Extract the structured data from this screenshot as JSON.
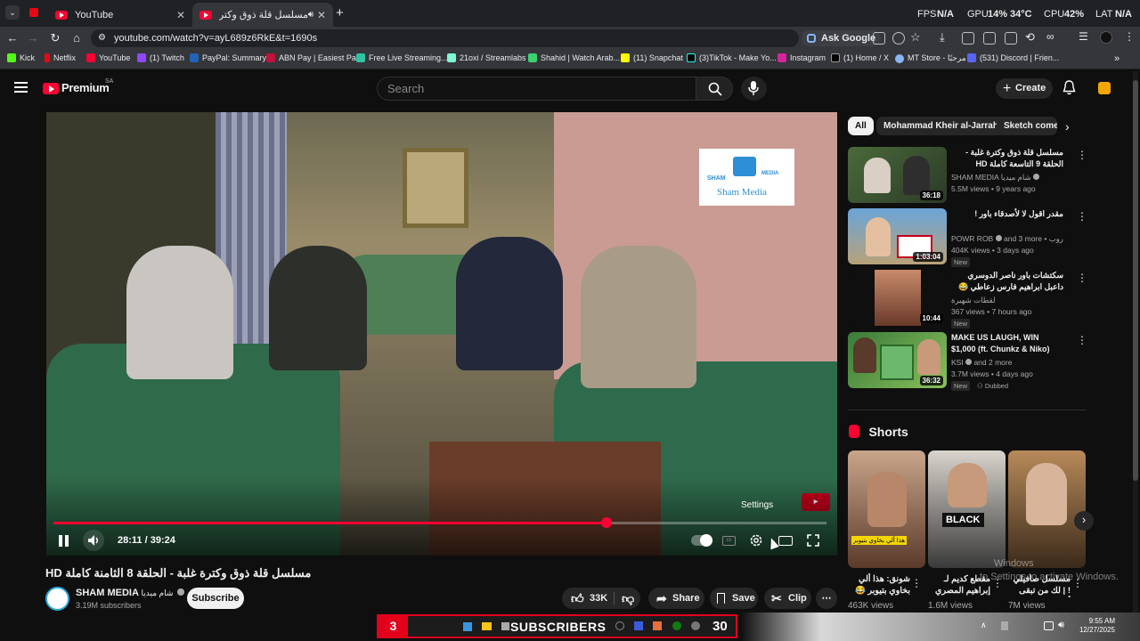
{
  "browser": {
    "tabs": [
      {
        "label": "YouTube",
        "active": false
      },
      {
        "label": "مسلسل قلة ذوق وكترة غلبة",
        "active": true
      }
    ],
    "hud": {
      "fps_label": "FPS",
      "fps": "N/A",
      "gpu_label": "GPU",
      "gpu": "14%",
      "gpu_temp": "34°C",
      "cpu_label": "CPU",
      "cpu": "42%",
      "lat_label": "LAT",
      "lat": "N/A"
    },
    "url": "youtube.com/watch?v=ayL689z6RkE&t=1690s",
    "ask_google": "Ask Google",
    "bookmarks": [
      "Kick",
      "Netflix",
      "YouTube",
      "(1) Twitch",
      "PayPal: Summary",
      "ABN Pay | Easiest Pa...",
      "Free Live Streaming...",
      "21oxi / Streamlabs",
      "Shahid | Watch Arab...",
      "(11) Snapchat",
      "(3)TikTok - Make Yo...",
      "Instagram",
      "(1) Home / X",
      "MT Store - مرحبًا",
      "(531) Discord | Frien..."
    ]
  },
  "masthead": {
    "logo": "Premium",
    "region": "SA",
    "search_placeholder": "Search",
    "create_label": "Create"
  },
  "player": {
    "time_current": "28:11",
    "time_total": "39:24",
    "progress": 0.715,
    "tooltip": "Settings",
    "overlay_logo_text": "Sham Media",
    "overlay_logo_tag": "SHAM",
    "overlay_logo_tag2": "MEDIA"
  },
  "video": {
    "title": "مسلسل قلة ذوق وكترة غلبة - الحلقة 8 الثامنة كاملة HD",
    "channel": "SHAM MEDIA",
    "channel_alt": "شام ميديا",
    "subscribers": "3.19M subscribers",
    "subscribe_label": "Subscribe",
    "likes": "33K",
    "share_label": "Share",
    "save_label": "Save",
    "clip_label": "Clip"
  },
  "sidebar": {
    "chips": [
      "All",
      "Mohammad Kheir al-Jarrah",
      "Sketch come"
    ],
    "videos": [
      {
        "title": "مسلسل قلة ذوق وكترة غلبة - الحلقة 9 التاسعة كاملة HD",
        "channel": "SHAM MEDIA",
        "channel_alt": "شام ميديا",
        "meta": "5.5M views • 9 years ago",
        "duration": "36:18",
        "badge": ""
      },
      {
        "title": "مقدر اقول لا لأصدقاء باور !",
        "channel": "POWR ROB",
        "channel_alt": "and 3 more • روب",
        "meta": "404K views • 3 days ago",
        "duration": "1:03:04",
        "badge": "New"
      },
      {
        "title": "سكتشات باور ناصر الدوسري داعبل ابراهيم فارس زعاطي 😂😂 #باور",
        "channel": "لقطات شهيرة",
        "channel_alt": "",
        "meta": "367 views • 7 hours ago",
        "duration": "10:44",
        "badge": "New"
      },
      {
        "title": "MAKE US LAUGH, WIN $1,000 (ft. Chunkz & Niko)",
        "channel": "KSI",
        "channel_alt": "and 2 more",
        "meta": "3.7M views • 4 days ago",
        "duration": "36:32",
        "badge": "New",
        "badge2": "Dubbed"
      }
    ],
    "shorts_heading": "Shorts",
    "shorts": [
      {
        "title": "شونق: هذا ألي بخاوي بتيوبر 😂",
        "views": "463K views",
        "caption": "هذا ألي بخاوي بتيوبر"
      },
      {
        "title": "مقطع كديم لـ إبراهيم المصري ...",
        "views": "1.6M views",
        "caption": "BLACK"
      },
      {
        "title": "مسلسل صافيلي ! | لك من تبقى أيها ...",
        "views": "7M views",
        "caption": ""
      }
    ]
  },
  "taskbar": {
    "left_count": "3",
    "label": "SUBSCRIBERS",
    "count": "30",
    "time": "9:55 AM",
    "date": "12/27/2025"
  },
  "watermark": {
    "line1": "Windows",
    "line2": "to Settings to activate Windows."
  },
  "colors": {
    "accent": "#ff0033",
    "bg": "#0f0f0f",
    "chrome": "#35363a"
  }
}
